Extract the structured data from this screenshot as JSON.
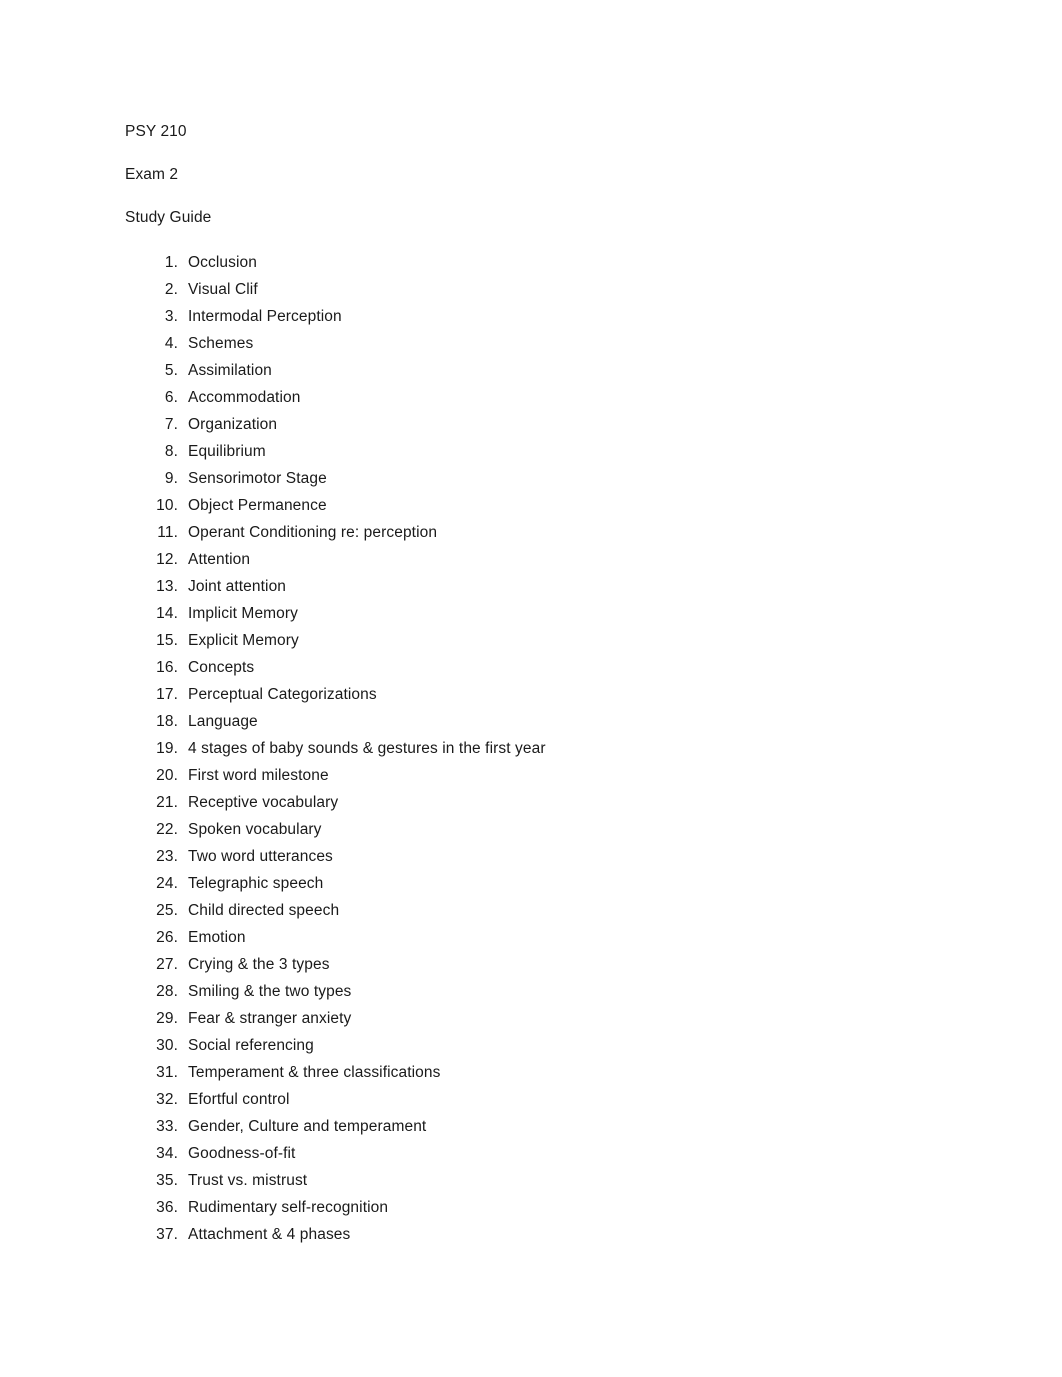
{
  "document": {
    "heading_lines": [
      "PSY 210",
      "Exam 2",
      "Study Guide"
    ],
    "list": [
      {
        "number": "1.",
        "text": "Occlusion"
      },
      {
        "number": "2.",
        "text": "Visual Clif"
      },
      {
        "number": "3.",
        "text": "Intermodal Perception"
      },
      {
        "number": "4.",
        "text": "Schemes"
      },
      {
        "number": "5.",
        "text": "Assimilation"
      },
      {
        "number": "6.",
        "text": "Accommodation"
      },
      {
        "number": "7.",
        "text": "Organization"
      },
      {
        "number": "8.",
        "text": "Equilibrium"
      },
      {
        "number": "9.",
        "text": "Sensorimotor Stage"
      },
      {
        "number": "10.",
        "text": "Object Permanence"
      },
      {
        "number": "11.",
        "text": "Operant Conditioning re: perception"
      },
      {
        "number": "12.",
        "text": "Attention"
      },
      {
        "number": "13.",
        "text": "Joint attention"
      },
      {
        "number": "14.",
        "text": "Implicit Memory"
      },
      {
        "number": "15.",
        "text": "Explicit Memory"
      },
      {
        "number": "16.",
        "text": "Concepts"
      },
      {
        "number": "17.",
        "text": "Perceptual Categorizations"
      },
      {
        "number": "18.",
        "text": "Language"
      },
      {
        "number": "19.",
        "text": "4 stages of baby sounds & gestures in the first year"
      },
      {
        "number": "20.",
        "text": "First word milestone"
      },
      {
        "number": "21.",
        "text": "Receptive vocabulary"
      },
      {
        "number": "22.",
        "text": "Spoken vocabulary"
      },
      {
        "number": "23.",
        "text": "Two word utterances"
      },
      {
        "number": "24.",
        "text": "Telegraphic speech"
      },
      {
        "number": "25.",
        "text": "Child directed speech"
      },
      {
        "number": "26.",
        "text": "Emotion"
      },
      {
        "number": "27.",
        "text": "Crying & the 3 types"
      },
      {
        "number": "28.",
        "text": "Smiling & the two types"
      },
      {
        "number": "29.",
        "text": "Fear & stranger anxiety"
      },
      {
        "number": "30.",
        "text": "Social referencing"
      },
      {
        "number": "31.",
        "text": "Temperament & three classifications"
      },
      {
        "number": "32.",
        "text": "Efortful control"
      },
      {
        "number": "33.",
        "text": "Gender, Culture and temperament"
      },
      {
        "number": "34.",
        "text": "Goodness-of-fit"
      },
      {
        "number": "35.",
        "text": "Trust vs. mistrust"
      },
      {
        "number": "36.",
        "text": "Rudimentary self-recognition"
      },
      {
        "number": "37.",
        "text": "Attachment & 4 phases"
      }
    ]
  }
}
